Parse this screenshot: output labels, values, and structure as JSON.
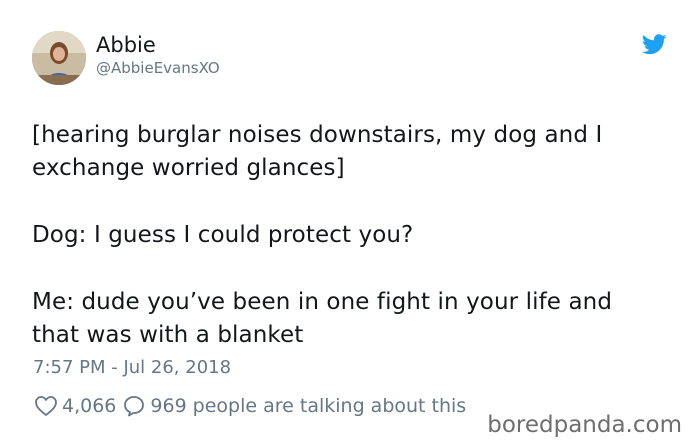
{
  "author": {
    "display_name": "Abbie",
    "handle": "@AbbieEvansXO"
  },
  "tweet": {
    "paragraphs": [
      "[hearing burglar noises downstairs, my dog and I\nexchange worried glances]",
      "Dog: I guess I could protect you?",
      "Me: dude you’ve been in one fight in your life and\nthat was with a blanket"
    ],
    "timestamp": "7:57 PM - Jul 26, 2018"
  },
  "stats": {
    "likes": "4,066",
    "replies": "969",
    "replies_suffix": "people are talking about this"
  },
  "watermark": "boredpanda.com",
  "icons": {
    "brand": "twitter-bird-icon",
    "like": "heart-icon",
    "reply": "speech-bubble-icon"
  },
  "colors": {
    "twitter_blue": "#1da1f2",
    "secondary_text": "#657786",
    "primary_text": "#14171a"
  }
}
